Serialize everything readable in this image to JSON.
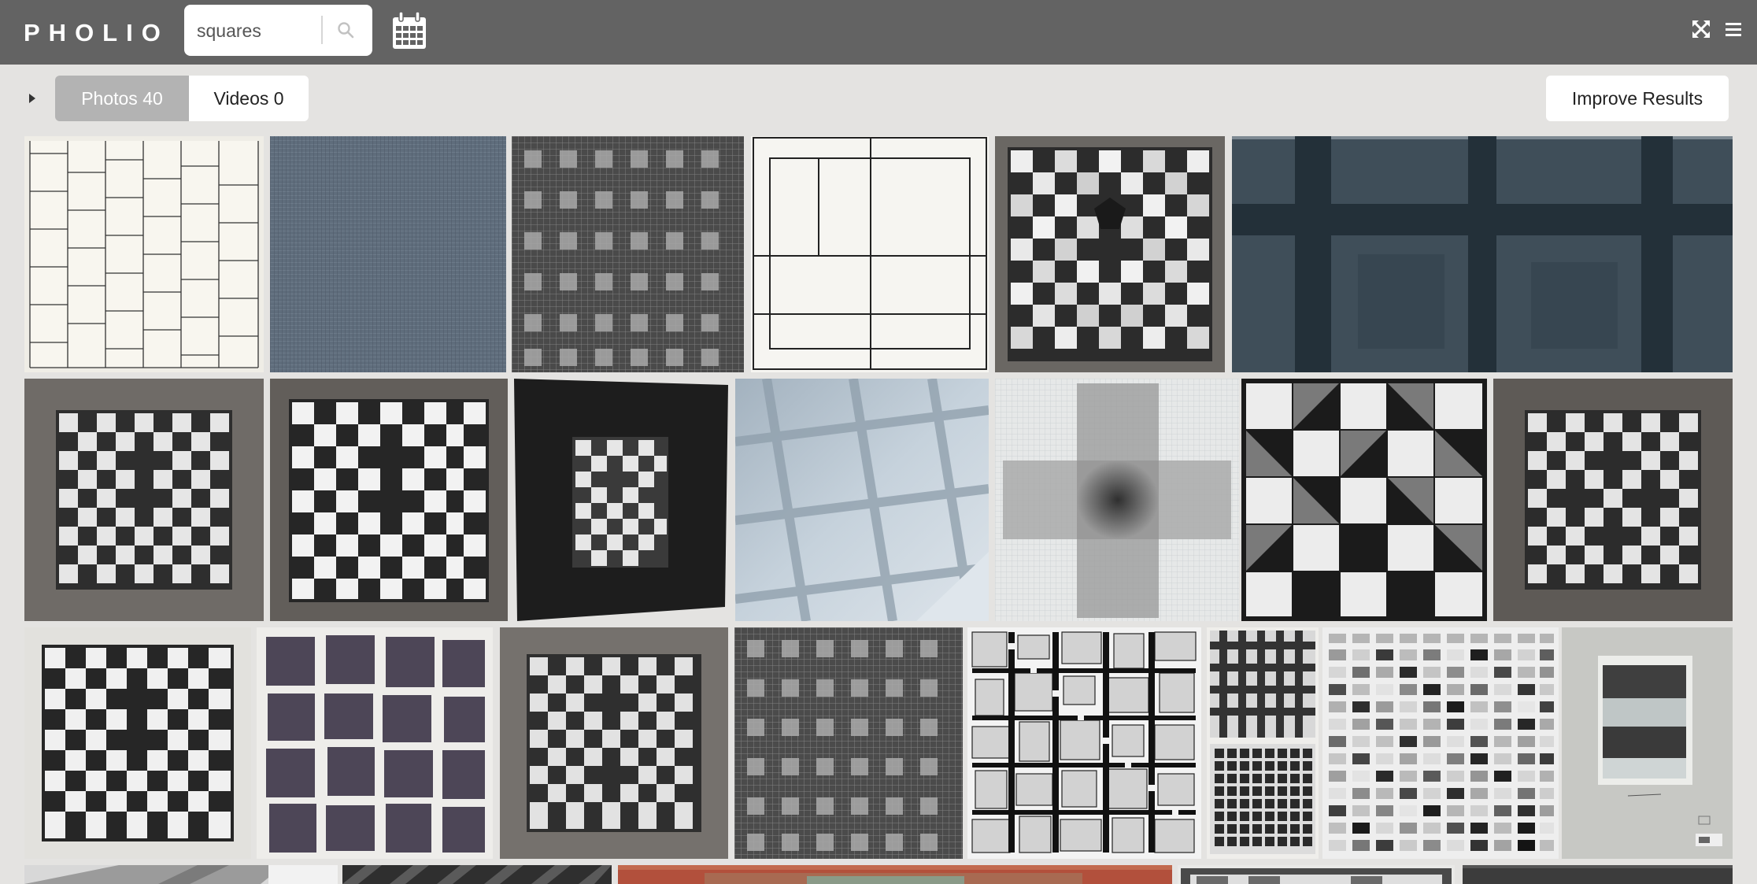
{
  "app": {
    "logo": "PHOLIO"
  },
  "search": {
    "value": "squares",
    "icon": "search-icon"
  },
  "topbar": {
    "calendar_icon": "calendar-icon",
    "fullscreen_icon": "fullscreen-icon",
    "menu_icon": "hamburger-menu-icon"
  },
  "filters": {
    "photos_label": "Photos 40",
    "videos_label": "Videos 0",
    "improve_label": "Improve Results"
  },
  "colors": {
    "topbar": "#636363",
    "background": "#e4e3e1",
    "active_tab": "#b3b3b3"
  },
  "photos": [
    {
      "id": "p1",
      "subject": "line grid drawing on cream paper"
    },
    {
      "id": "p2",
      "subject": "blue-gray fine grid weave"
    },
    {
      "id": "p3",
      "subject": "graph paper with shaded squares"
    },
    {
      "id": "p4",
      "subject": "rectangles line drawing"
    },
    {
      "id": "p5",
      "subject": "folded paper checker relief"
    },
    {
      "id": "p6",
      "subject": "dark blue cross painting"
    },
    {
      "id": "p7",
      "subject": "folded paper checker relief"
    },
    {
      "id": "p8",
      "subject": "folded paper checker relief"
    },
    {
      "id": "p9",
      "subject": "folded paper relief on black"
    },
    {
      "id": "p10",
      "subject": "light blue shadow grid"
    },
    {
      "id": "p11",
      "subject": "pencil cross on graph paper"
    },
    {
      "id": "p12",
      "subject": "large folded paper checker"
    },
    {
      "id": "p13",
      "subject": "folded paper checker relief"
    },
    {
      "id": "p14",
      "subject": "folded paper checker relief"
    },
    {
      "id": "p15",
      "subject": "purple cut paper squares"
    },
    {
      "id": "p16",
      "subject": "folded paper checker relief"
    },
    {
      "id": "p17",
      "subject": "graph paper with shaded squares"
    },
    {
      "id": "p18",
      "subject": "gray squares composition"
    },
    {
      "id": "p19",
      "subject": "woven grid studies"
    },
    {
      "id": "p20",
      "subject": "gray value swatches"
    },
    {
      "id": "p21",
      "subject": "mounted gray panel"
    },
    {
      "id": "p22",
      "subject": "gray diagonal stripes"
    },
    {
      "id": "p23",
      "subject": "dark diagonal stripes"
    },
    {
      "id": "p24",
      "subject": "red painting"
    },
    {
      "id": "p25",
      "subject": "framed work"
    },
    {
      "id": "p26",
      "subject": "dark panel"
    }
  ]
}
